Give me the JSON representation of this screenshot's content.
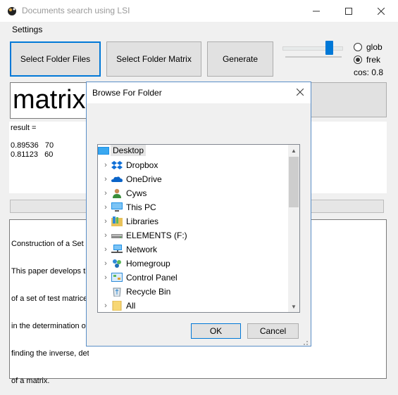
{
  "window": {
    "title": "Documents search using LSI",
    "menu": [
      "Settings"
    ]
  },
  "toolbar": {
    "select_folder_files": "Select Folder Files",
    "select_folder_matrix": "Select Folder Matrix",
    "generate": "Generate"
  },
  "options": {
    "glob_label": "glob",
    "frek_label": "frek",
    "selected": "frek",
    "cos_label": "cos: 0.8"
  },
  "query": {
    "text": "matrix"
  },
  "result": {
    "label": "result =",
    "rows": [
      "0.89536   70",
      "0.81123   60"
    ]
  },
  "document": {
    "lines": [
      "Construction of a Set of Test Matrices",
      "This paper develops the construction",
      "of a set of test matrices useful",
      "in the determination of methods for",
      "finding the inverse, determinant,",
      "of a matrix."
    ]
  },
  "dialog": {
    "title": "Browse For Folder",
    "close": "✕",
    "tree": [
      {
        "label": "Desktop",
        "icon": "desktop-icon"
      },
      {
        "label": "Dropbox",
        "icon": "dropbox-icon"
      },
      {
        "label": "OneDrive",
        "icon": "onedrive-icon"
      },
      {
        "label": "Cyws",
        "icon": "user-icon"
      },
      {
        "label": "This PC",
        "icon": "computer-icon"
      },
      {
        "label": "Libraries",
        "icon": "libraries-icon"
      },
      {
        "label": "ELEMENTS (F:)",
        "icon": "drive-icon"
      },
      {
        "label": "Network",
        "icon": "network-icon"
      },
      {
        "label": "Homegroup",
        "icon": "homegroup-icon"
      },
      {
        "label": "Control Panel",
        "icon": "control-panel-icon"
      },
      {
        "label": "Recycle Bin",
        "icon": "recycle-bin-icon"
      },
      {
        "label": "All",
        "icon": "folder-icon"
      }
    ],
    "ok": "OK",
    "cancel": "Cancel"
  },
  "colors": {
    "accent": "#0078d7",
    "selection": "#e5e5e5"
  }
}
